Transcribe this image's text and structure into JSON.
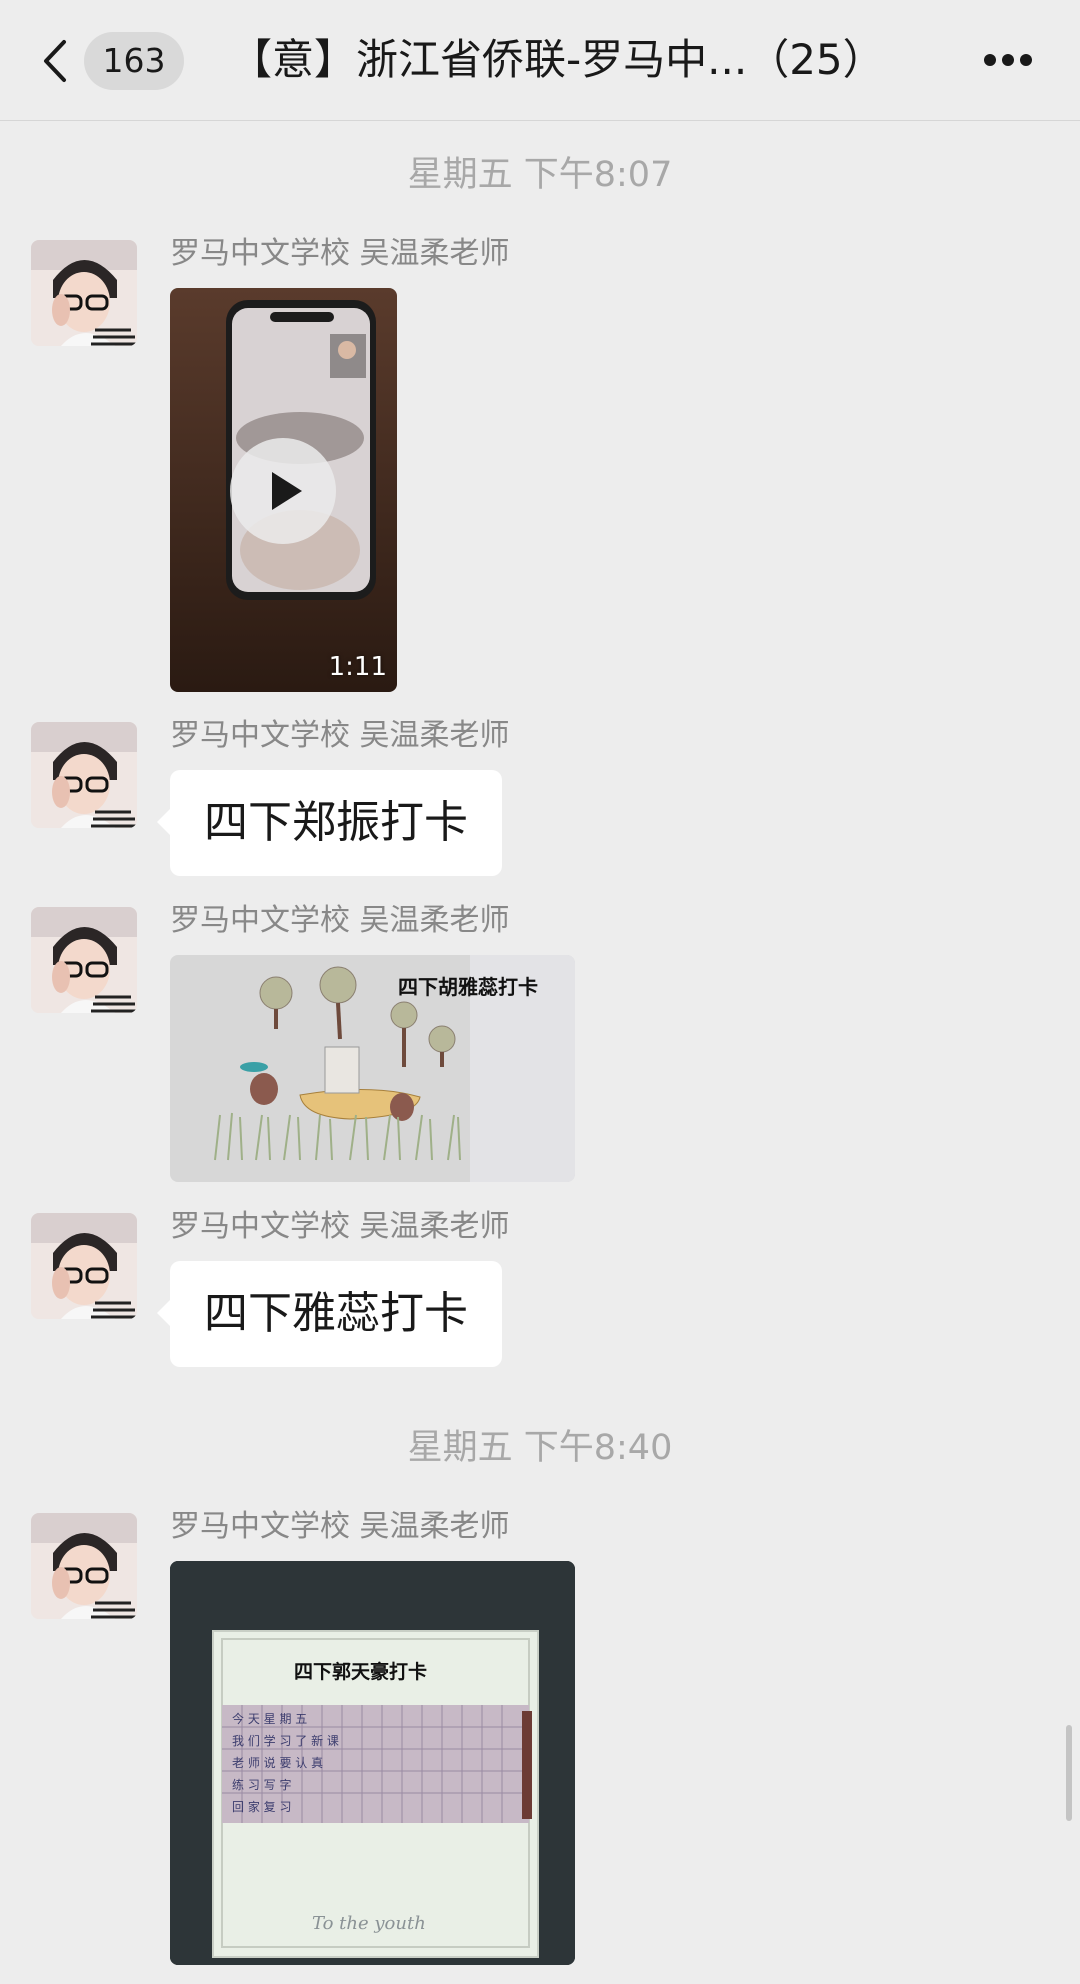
{
  "nav": {
    "unread_count": "163",
    "title": "【意】浙江省侨联-罗马中...（25）"
  },
  "timestamps": [
    "星期五 下午8:07",
    "星期五 下午8:40"
  ],
  "messages": [
    {
      "sender": "罗马中文学校 吴温柔老师",
      "type": "video",
      "duration": "1:11"
    },
    {
      "sender": "罗马中文学校 吴温柔老师",
      "type": "text",
      "text": "四下郑振打卡"
    },
    {
      "sender": "罗马中文学校 吴温柔老师",
      "type": "image",
      "caption": "四下胡雅蕊打卡"
    },
    {
      "sender": "罗马中文学校 吴温柔老师",
      "type": "text",
      "text": "四下雅蕊打卡"
    },
    {
      "sender": "罗马中文学校 吴温柔老师",
      "type": "image",
      "caption": "四下郭天豪打卡",
      "footer": "To the youth"
    }
  ],
  "icons": {
    "back": "chevron-left-icon",
    "more": "more-dots-icon",
    "play": "play-icon"
  }
}
